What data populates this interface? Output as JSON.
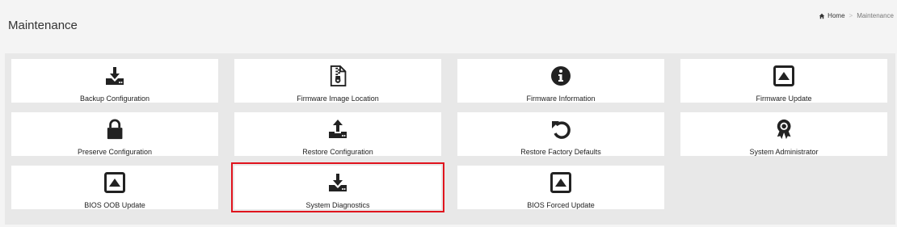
{
  "header": {
    "title": "Maintenance"
  },
  "breadcrumb": {
    "home": "Home",
    "current": "Maintenance"
  },
  "tiles": [
    {
      "label": "Backup Configuration"
    },
    {
      "label": "Firmware Image Location"
    },
    {
      "label": "Firmware Information"
    },
    {
      "label": "Firmware Update"
    },
    {
      "label": "Preserve Configuration"
    },
    {
      "label": "Restore Configuration"
    },
    {
      "label": "Restore Factory Defaults"
    },
    {
      "label": "System Administrator"
    },
    {
      "label": "BIOS OOB Update"
    },
    {
      "label": "System Diagnostics"
    },
    {
      "label": "BIOS Forced Update"
    }
  ],
  "colors": {
    "highlight": "#e0141e",
    "icon": "#222222"
  },
  "icons": [
    "download-drive-icon",
    "file-zip-icon",
    "info-circle-icon",
    "upload-box-icon",
    "lock-icon",
    "upload-drive-icon",
    "undo-icon",
    "award-icon",
    "upload-box-icon",
    "download-drive-icon",
    "upload-box-icon"
  ]
}
